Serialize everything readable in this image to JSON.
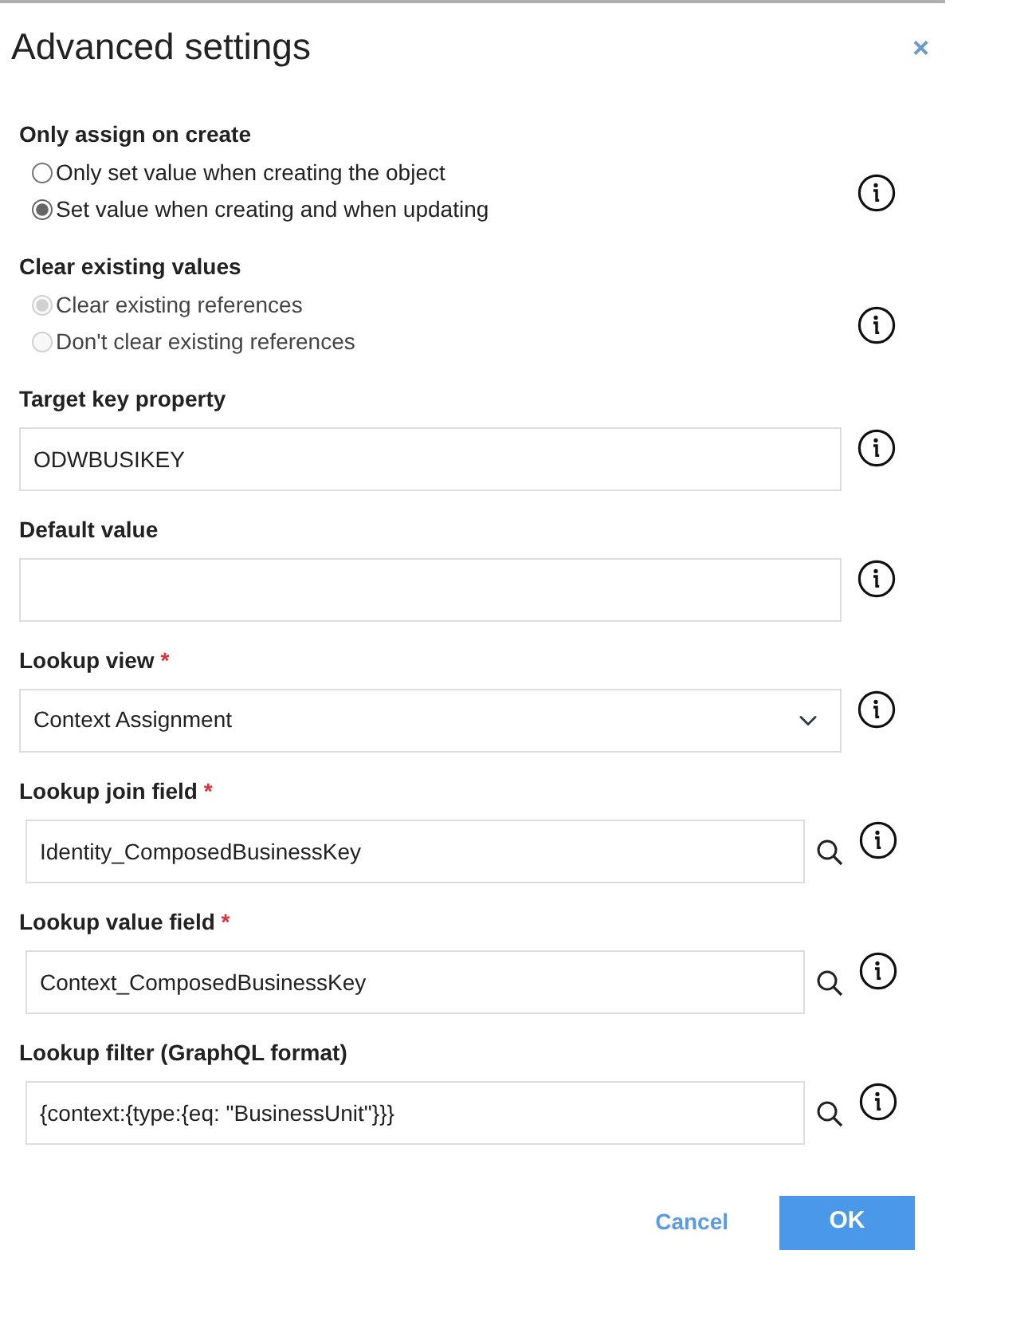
{
  "dialog": {
    "title": "Advanced settings",
    "close": "×"
  },
  "fields": [
    {
      "kind": "radio",
      "label": "Only assign on create",
      "disabled": false,
      "options": [
        {
          "label": "Only set value when creating the object",
          "selected": false
        },
        {
          "label": "Set value when creating and when updating",
          "selected": true
        }
      ]
    },
    {
      "kind": "radio",
      "label": "Clear existing values",
      "disabled": true,
      "options": [
        {
          "label": "Clear existing references",
          "selected": true
        },
        {
          "label": "Don't clear existing references",
          "selected": false
        }
      ]
    },
    {
      "kind": "text",
      "label": "Target key property",
      "value": "ODWBUSIKEY"
    },
    {
      "kind": "text",
      "label": "Default value"
    },
    {
      "kind": "select",
      "label": "Lookup view",
      "required_mark": "*",
      "value": "Context Assignment"
    },
    {
      "kind": "lookup",
      "label": "Lookup join field",
      "required_mark": "*",
      "value": "Identity_ComposedBusinessKey"
    },
    {
      "kind": "lookup",
      "label": "Lookup value field",
      "required_mark": "*",
      "value": "Context_ComposedBusinessKey"
    },
    {
      "kind": "lookup",
      "label": "Lookup filter (GraphQL format)",
      "value": "{context:{type:{eq: \"BusinessUnit\"}}}"
    }
  ],
  "buttons": [
    {
      "kind": "link",
      "label": "Cancel"
    },
    {
      "kind": "primary",
      "label": "OK"
    }
  ]
}
